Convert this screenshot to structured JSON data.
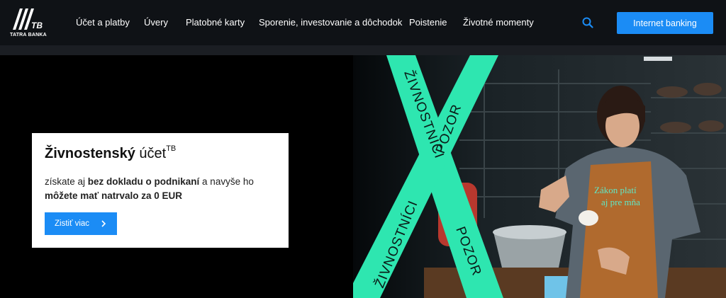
{
  "brand": {
    "logo_mark": "TB",
    "logo_text": "TATRA BANKA"
  },
  "nav": {
    "items": [
      {
        "label": "Účet a platby"
      },
      {
        "label": "Úvery"
      },
      {
        "label": "Platobné karty"
      },
      {
        "label": "Sporenie, investovanie a dôchodok"
      },
      {
        "label": "Poistenie"
      },
      {
        "label": "Životné momenty"
      }
    ]
  },
  "header": {
    "search_icon": "search-icon",
    "internet_banking_label": "Internet banking"
  },
  "hero": {
    "card": {
      "title_bold": "Živnostenský",
      "title_rest": "účet",
      "title_sup": "TB",
      "text_1": "získate aj ",
      "text_bold_1": "bez dokladu o podnikaní",
      "text_2": " a navyše ho ",
      "text_bold_2": "môžete mať natrvalo za 0 EUR",
      "cta_label": "Zistiť viac"
    },
    "image": {
      "ribbon_text_1": "ŽIVNOSTNÍCI",
      "ribbon_text_2": "POZOR",
      "ribbon_text_3": "ŽIVNOSTNÍCI",
      "ribbon_text_4": "POZOR",
      "apron_text_1": "Zákon platí",
      "apron_text_2": "aj pre mňa"
    }
  },
  "colors": {
    "accent": "#1b8cf5",
    "ribbon": "#2ee6b0",
    "topbar": "#0f1216"
  }
}
